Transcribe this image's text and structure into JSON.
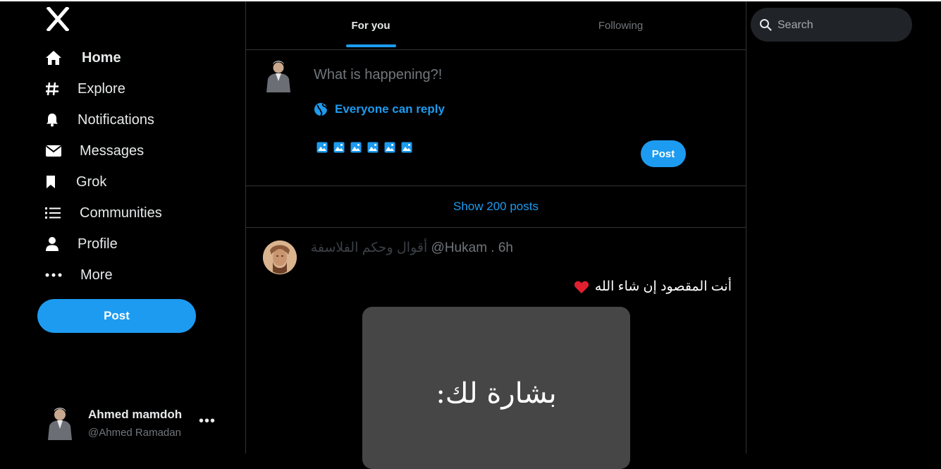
{
  "logo": {
    "icon": "x-logo-icon"
  },
  "nav": {
    "items": [
      {
        "label": "Home",
        "icon": "home-icon",
        "active": true
      },
      {
        "label": "Explore",
        "icon": "hashtag-icon"
      },
      {
        "label": "Notifications",
        "icon": "bell-icon"
      },
      {
        "label": "Messages",
        "icon": "envelope-icon"
      },
      {
        "label": "Grok",
        "icon": "bookmark-icon"
      },
      {
        "label": "Communities",
        "icon": "list-icon"
      },
      {
        "label": "Profile",
        "icon": "person-icon"
      },
      {
        "label": "More",
        "icon": "more-dots-icon"
      }
    ],
    "post_label": "Post"
  },
  "account": {
    "name": "Ahmed mamdoh",
    "handle": "@Ahmed Ramadan",
    "menu": "•••"
  },
  "tabs": [
    {
      "label": "For you",
      "selected": true
    },
    {
      "label": "Following",
      "selected": false
    }
  ],
  "compose": {
    "placeholder": "What is happening?!",
    "reply_setting": "Everyone can reply",
    "media_icons": [
      "image-icon",
      "image-icon",
      "image-icon",
      "image-icon",
      "image-icon",
      "image-icon"
    ],
    "post_label": "Post"
  },
  "feed": {
    "show_posts": "Show 200 posts"
  },
  "tweet": {
    "author": "أقوال وحكم الفلاسفة",
    "handle_time": "@Hukam . 6h",
    "text": "أنت المقصود إن شاء الله",
    "media_text": "بشارة لك:"
  },
  "search": {
    "placeholder": "Search"
  },
  "colors": {
    "accent": "#1d9bf0",
    "background": "#000000",
    "border": "#2f3336",
    "muted": "#71767b"
  }
}
